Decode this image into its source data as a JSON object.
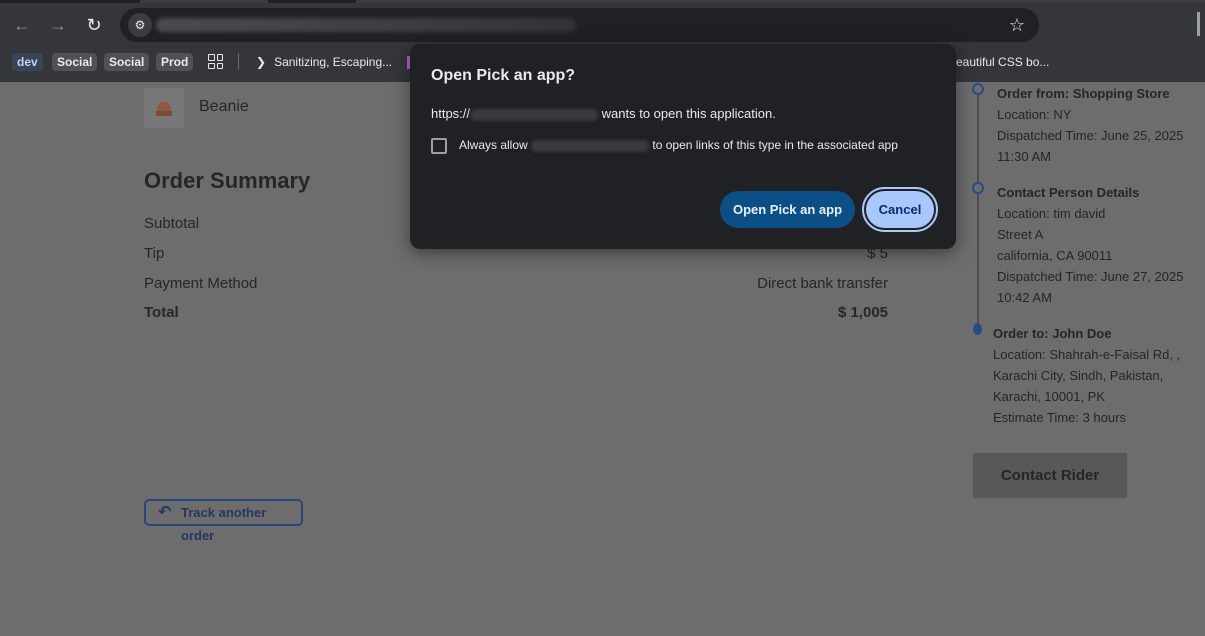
{
  "browser": {
    "back_icon": "arrow-left-icon",
    "forward_icon": "arrow-right-icon",
    "reload_icon": "reload-icon",
    "site_settings_icon": "tune-icon",
    "bookmark_icon": "star-icon",
    "bookmarks": [
      {
        "label": "dev"
      },
      {
        "label": "Social"
      },
      {
        "label": "Social"
      },
      {
        "label": "Prod"
      },
      {
        "label": "Sanitizing, Escaping..."
      },
      {
        "label": "eautiful CSS bo..."
      }
    ]
  },
  "product": {
    "name": "Beanie"
  },
  "order_summary": {
    "title": "Order Summary",
    "rows": [
      {
        "label": "Subtotal",
        "value": ""
      },
      {
        "label": "Tip",
        "value": "$ 5"
      },
      {
        "label": "Payment Method",
        "value": "Direct bank transfer"
      },
      {
        "label": "Total",
        "value": "$ 1,005"
      }
    ]
  },
  "track_button": {
    "label": "Track another order"
  },
  "timeline": [
    {
      "heading": "Order from: Shopping Store",
      "lines": [
        "Location: NY",
        "Dispatched Time: June 25, 2025",
        "11:30 AM"
      ]
    },
    {
      "heading": "Contact Person Details",
      "lines": [
        "Location: tim david",
        "Street A",
        "california, CA 90011",
        "Dispatched Time: June 27, 2025",
        "10:42 AM"
      ]
    },
    {
      "heading": "Order to: John Doe",
      "lines": [
        "Location: Shahrah-e-Faisal Rd, ,",
        "Karachi City, Sindh, Pakistan,",
        "Karachi, 10001, PK",
        "Estimate Time: 3 hours"
      ]
    }
  ],
  "contact_rider": {
    "label": "Contact Rider"
  },
  "dialog": {
    "title": "Open Pick an app?",
    "message_prefix": "https://",
    "message_suffix": "wants to open this application.",
    "checkbox_prefix": "Always allow",
    "checkbox_suffix": "to open links of this type in the associated app",
    "checkbox_checked": false,
    "open_button": "Open Pick an app",
    "cancel_button": "Cancel"
  },
  "colors": {
    "overlay_page": "#6d6d6d",
    "dialog_bg": "#202124",
    "primary_button": "#0b4f86",
    "cancel_button": "#a8c7fa",
    "timeline_accent": "#274c86"
  }
}
